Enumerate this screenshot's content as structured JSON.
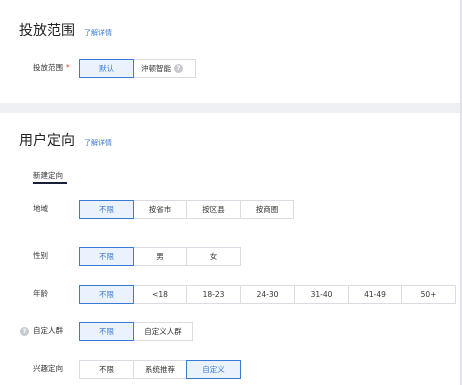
{
  "sections": {
    "scope": {
      "title": "投放范围",
      "detail_link": "了解详情",
      "label": "投放范围",
      "required_mark": "*",
      "options": [
        "默认",
        "沖顿智能"
      ],
      "selected": "默认"
    },
    "user": {
      "title": "用户定向",
      "detail_link": "了解详情",
      "tab": "新建定向"
    }
  },
  "rows": {
    "region": {
      "label": "地域",
      "options": [
        "不限",
        "按省市",
        "按区县",
        "按商圈"
      ],
      "selected": "不限"
    },
    "gender": {
      "label": "性别",
      "options": [
        "不限",
        "男",
        "女"
      ],
      "selected": "不限"
    },
    "age": {
      "label": "年龄",
      "options": [
        "不限",
        "<18",
        "18-23",
        "24-30",
        "31-40",
        "41-49",
        "50+"
      ],
      "selected": "不限"
    },
    "custom": {
      "label": "自定人群",
      "options": [
        "不限",
        "自定义人群"
      ],
      "selected": "不限"
    },
    "interest": {
      "label": "兴趣定向",
      "options": [
        "不限",
        "系统推荐",
        "自定义"
      ],
      "selected": "自定义"
    }
  },
  "icons": {
    "help": "?"
  },
  "colors": {
    "accent": "#3a7bd5",
    "required": "#e0443b"
  }
}
